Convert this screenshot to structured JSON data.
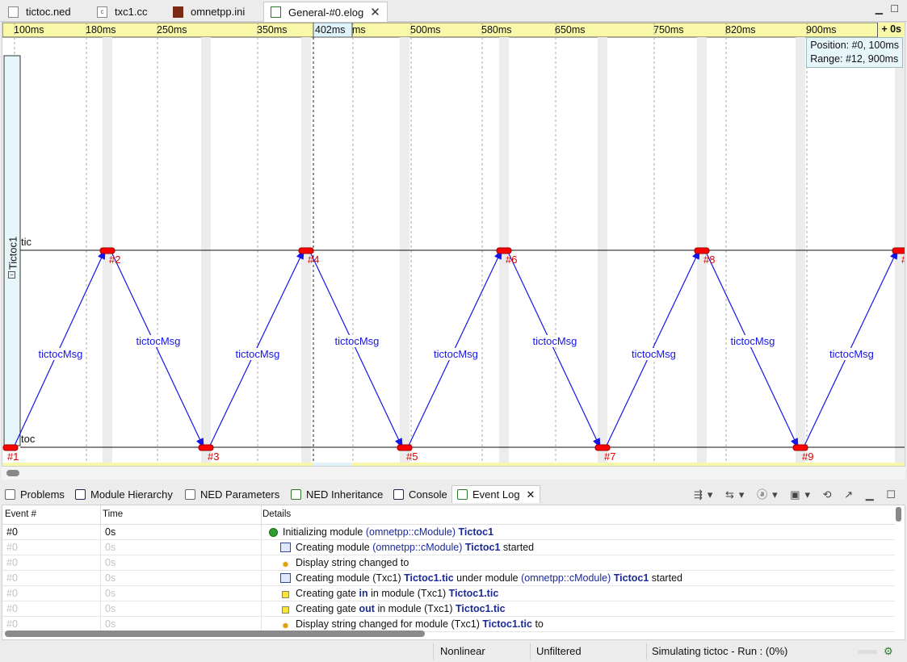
{
  "editor_tabs": [
    {
      "label": "tictoc.ned",
      "icon": "ned-file-icon"
    },
    {
      "label": "txc1.cc",
      "icon": "cc-file-icon"
    },
    {
      "label": "omnetpp.ini",
      "icon": "ini-file-icon"
    },
    {
      "label": "General-#0.elog",
      "icon": "elog-file-icon",
      "active": true
    }
  ],
  "ruler": {
    "ticks": [
      "100ms",
      "180ms",
      "250ms",
      "350ms",
      "ms",
      "500ms",
      "580ms",
      "650ms",
      "750ms",
      "820ms",
      "900ms"
    ],
    "cursor_label": "402ms",
    "offset_label": "+ 0s"
  },
  "info_box": {
    "position": "Position: #0, 100ms",
    "range": "Range: #12, 900ms"
  },
  "chart": {
    "module_name": "Tictoc1",
    "axes": [
      "tic",
      "toc"
    ],
    "message_name": "tictocMsg",
    "events": [
      "#1",
      "#2",
      "#3",
      "#4",
      "#5",
      "#6",
      "#7",
      "#8",
      "#9",
      "#"
    ],
    "accent_color": "#ff0000",
    "arrow_color": "#1515e8"
  },
  "view_tabs": [
    {
      "label": "Problems",
      "icon": "problems-icon"
    },
    {
      "label": "Module Hierarchy",
      "icon": "module-hierarchy-icon"
    },
    {
      "label": "NED Parameters",
      "icon": "ned-parameters-icon"
    },
    {
      "label": "NED Inheritance",
      "icon": "ned-inheritance-icon"
    },
    {
      "label": "Console",
      "icon": "console-icon"
    },
    {
      "label": "Event Log",
      "icon": "event-log-icon",
      "active": true
    }
  ],
  "event_log": {
    "headers": [
      "Event #",
      "Time",
      "Details"
    ],
    "rows": [
      {
        "event": "#0",
        "time": "0s",
        "icon": "green-dot-icon",
        "dim": false,
        "indent": false,
        "parts": [
          {
            "t": "Initializing module "
          },
          {
            "t": "(omnetpp::cModule)",
            "c": "hl"
          },
          {
            "t": " "
          },
          {
            "t": "Tictoc1",
            "c": "b"
          }
        ]
      },
      {
        "event": "#0",
        "time": "0s",
        "icon": "create-module-icon",
        "dim": true,
        "indent": true,
        "parts": [
          {
            "t": "Creating module "
          },
          {
            "t": "(omnetpp::cModule)",
            "c": "hl"
          },
          {
            "t": " "
          },
          {
            "t": "Tictoc1",
            "c": "b"
          },
          {
            "t": " started"
          }
        ]
      },
      {
        "event": "#0",
        "time": "0s",
        "icon": "display-string-icon",
        "dim": true,
        "indent": true,
        "parts": [
          {
            "t": "Display string changed to"
          }
        ]
      },
      {
        "event": "#0",
        "time": "0s",
        "icon": "create-module-icon",
        "dim": true,
        "indent": true,
        "parts": [
          {
            "t": "Creating module (Txc1) "
          },
          {
            "t": "Tictoc1.tic",
            "c": "b"
          },
          {
            "t": " under module "
          },
          {
            "t": "(omnetpp::cModule)",
            "c": "hl"
          },
          {
            "t": " "
          },
          {
            "t": "Tictoc1",
            "c": "b"
          },
          {
            "t": " started"
          }
        ]
      },
      {
        "event": "#0",
        "time": "0s",
        "icon": "gate-icon",
        "dim": true,
        "indent": true,
        "parts": [
          {
            "t": "Creating gate "
          },
          {
            "t": "in",
            "c": "b"
          },
          {
            "t": " in module (Txc1) "
          },
          {
            "t": "Tictoc1.tic",
            "c": "b"
          }
        ]
      },
      {
        "event": "#0",
        "time": "0s",
        "icon": "gate-icon",
        "dim": true,
        "indent": true,
        "parts": [
          {
            "t": "Creating gate "
          },
          {
            "t": "out",
            "c": "b"
          },
          {
            "t": " in module (Txc1) "
          },
          {
            "t": "Tictoc1.tic",
            "c": "b"
          }
        ]
      },
      {
        "event": "#0",
        "time": "0s",
        "icon": "display-string-icon",
        "dim": true,
        "indent": true,
        "parts": [
          {
            "t": "Display string changed for module (Txc1) "
          },
          {
            "t": "Tictoc1.tic",
            "c": "b"
          },
          {
            "t": " to"
          }
        ]
      }
    ]
  },
  "status_bar": {
    "mode": "Nonlinear",
    "filter": "Unfiltered",
    "progress": "Simulating tictoc - Run : (0%)"
  }
}
